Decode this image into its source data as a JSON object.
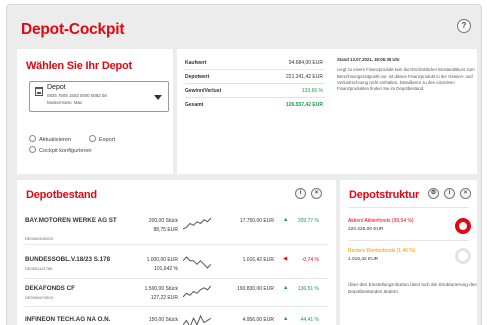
{
  "page": {
    "title": "Depot-Cockpit",
    "help_label": "?"
  },
  "select_panel": {
    "title": "Wählen Sie Ihr Depot",
    "depot": {
      "name": "Depot",
      "iban": "0835 7505 1503 0000 5082 08",
      "owner": "Mustermann, Max"
    },
    "actions": [
      {
        "label": "Aktualisieren",
        "icon": "refresh-icon"
      },
      {
        "label": "Export",
        "icon": "export-icon"
      },
      {
        "label": "Cockpit konfigurieren",
        "icon": "settings-icon"
      }
    ]
  },
  "summary": {
    "rows": [
      {
        "label": "Kaufwert",
        "value": "94.684,00 EUR",
        "color": "#333333"
      },
      {
        "label": "Depotwert",
        "value": "221.241,42 EUR",
        "color": "#333333"
      },
      {
        "label": "Gewinn/Verlust",
        "value": "133,66 %",
        "color": "#1a9b4a"
      },
      {
        "label": "Gesamt",
        "value": "126.557,42 EUR",
        "color": "#1a9b4a"
      }
    ],
    "info_title": "Stand 13.07.2021, 18:06:35 Uhr",
    "info_text": "Liegt zu einem Finanzprodukt kein durchschnittlicher Einstandskurs zum Berechnungszeitpunkt vor, ist dieses Finanzprodukt in der Gewinn- und Verlustrechnung nicht enthalten. Detaillieren zu den einzelnen Finanzprodukten finden Sie im Depotbestand."
  },
  "holdings": {
    "title": "Depotbestand",
    "info_label": "i",
    "close_label": "×",
    "rows": [
      {
        "name": "BAY.MOTOREN WERKE AG ST",
        "isin": "DE0005190003",
        "qty": "200,00 Stück",
        "price": "88,75 EUR",
        "value": "17.750,00 EUR",
        "trend": "up",
        "pct": "209,77 %",
        "spark": [
          2,
          3,
          5,
          4,
          6,
          5,
          7,
          6,
          8
        ]
      },
      {
        "name": "BUNDESSOBL.V.18/23 S.178",
        "isin": "DE0001141786",
        "qty": "1.000,00 EUR",
        "price": "101,642 %",
        "value": "1.016,42 EUR",
        "trend": "down",
        "pct": "-0,74 %",
        "spark": [
          6,
          7,
          6,
          6,
          5,
          6,
          5,
          4,
          5
        ]
      },
      {
        "name": "DEKAFONDS CF",
        "isin": "DE0008474503",
        "qty": "1.500,00 Stück",
        "price": "127,22 EUR",
        "value": "190.830,00 EUR",
        "trend": "up",
        "pct": "136,51 %",
        "spark": [
          2,
          4,
          3,
          5,
          4,
          6,
          7,
          6,
          8
        ]
      },
      {
        "name": "INFINEON TECH.AG NA O.N.",
        "isin": "",
        "qty": "150,00 Stück",
        "price": "",
        "value": "4.956,00 EUR",
        "trend": "up",
        "pct": "44,41 %",
        "spark": [
          4,
          6,
          3,
          7,
          4,
          8,
          5,
          6,
          7
        ]
      }
    ]
  },
  "structure": {
    "title": "Depotstruktur",
    "items": [
      {
        "label": "Aktien/ Aktienfonds (99,54 %)",
        "value": "220.225,00 EUR",
        "color": "#e30613",
        "percent": 99.54
      },
      {
        "label": "Renten/ Rentenfonds (1,46 %)",
        "value": "1.016,42 EUR",
        "color": "#f39200",
        "percent": 1.46
      }
    ],
    "footer": "Über den Einstellungs-Button lässt sich die Strukturierung des Depotbestandes ändern."
  }
}
